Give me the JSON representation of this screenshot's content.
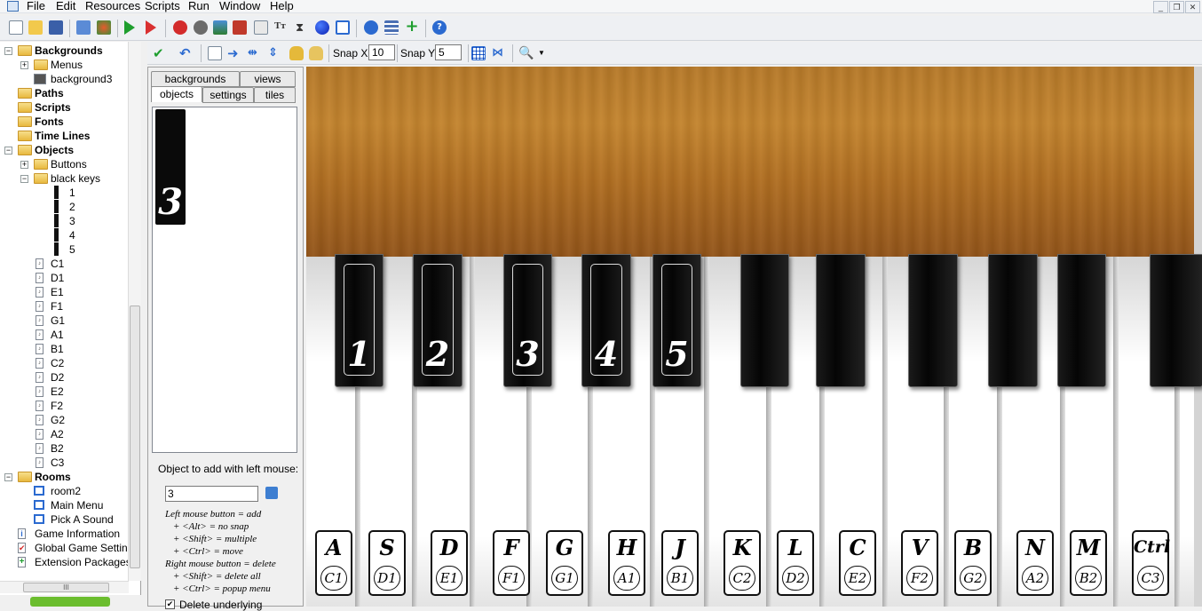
{
  "menu": [
    "File",
    "Edit",
    "Resources",
    "Scripts",
    "Run",
    "Window",
    "Help"
  ],
  "tree": {
    "items": [
      {
        "label": "Backgrounds",
        "level": 0,
        "bold": true,
        "kind": "folder",
        "exp": "-"
      },
      {
        "label": "Menus",
        "level": 1,
        "bold": false,
        "kind": "folder",
        "exp": "+"
      },
      {
        "label": "background3",
        "level": 1,
        "bold": false,
        "kind": "bg",
        "exp": ""
      },
      {
        "label": "Paths",
        "level": 0,
        "bold": true,
        "kind": "folder",
        "exp": ""
      },
      {
        "label": "Scripts",
        "level": 0,
        "bold": true,
        "kind": "folder",
        "exp": ""
      },
      {
        "label": "Fonts",
        "level": 0,
        "bold": true,
        "kind": "folder",
        "exp": ""
      },
      {
        "label": "Time Lines",
        "level": 0,
        "bold": true,
        "kind": "folder",
        "exp": ""
      },
      {
        "label": "Objects",
        "level": 0,
        "bold": true,
        "kind": "folder",
        "exp": "-"
      },
      {
        "label": "Buttons",
        "level": 1,
        "bold": false,
        "kind": "folder",
        "exp": "+"
      },
      {
        "label": "black keys",
        "level": 1,
        "bold": false,
        "kind": "folder",
        "exp": "-"
      },
      {
        "label": "1",
        "level": 2,
        "bold": false,
        "kind": "bk",
        "exp": ""
      },
      {
        "label": "2",
        "level": 2,
        "bold": false,
        "kind": "bk",
        "exp": ""
      },
      {
        "label": "3",
        "level": 2,
        "bold": false,
        "kind": "bk",
        "exp": ""
      },
      {
        "label": "4",
        "level": 2,
        "bold": false,
        "kind": "bk",
        "exp": ""
      },
      {
        "label": "5",
        "level": 2,
        "bold": false,
        "kind": "bk",
        "exp": ""
      },
      {
        "label": "C1",
        "level": 1,
        "bold": false,
        "kind": "res",
        "exp": ""
      },
      {
        "label": "D1",
        "level": 1,
        "bold": false,
        "kind": "res",
        "exp": ""
      },
      {
        "label": "E1",
        "level": 1,
        "bold": false,
        "kind": "res",
        "exp": ""
      },
      {
        "label": "F1",
        "level": 1,
        "bold": false,
        "kind": "res",
        "exp": ""
      },
      {
        "label": "G1",
        "level": 1,
        "bold": false,
        "kind": "res",
        "exp": ""
      },
      {
        "label": "A1",
        "level": 1,
        "bold": false,
        "kind": "res",
        "exp": ""
      },
      {
        "label": "B1",
        "level": 1,
        "bold": false,
        "kind": "res",
        "exp": ""
      },
      {
        "label": "C2",
        "level": 1,
        "bold": false,
        "kind": "res",
        "exp": ""
      },
      {
        "label": "D2",
        "level": 1,
        "bold": false,
        "kind": "res",
        "exp": ""
      },
      {
        "label": "E2",
        "level": 1,
        "bold": false,
        "kind": "res",
        "exp": ""
      },
      {
        "label": "F2",
        "level": 1,
        "bold": false,
        "kind": "res",
        "exp": ""
      },
      {
        "label": "G2",
        "level": 1,
        "bold": false,
        "kind": "res",
        "exp": ""
      },
      {
        "label": "A2",
        "level": 1,
        "bold": false,
        "kind": "res",
        "exp": ""
      },
      {
        "label": "B2",
        "level": 1,
        "bold": false,
        "kind": "res",
        "exp": ""
      },
      {
        "label": "C3",
        "level": 1,
        "bold": false,
        "kind": "res",
        "exp": ""
      },
      {
        "label": "Rooms",
        "level": 0,
        "bold": true,
        "kind": "folder",
        "exp": "-"
      },
      {
        "label": "room2",
        "level": 1,
        "bold": false,
        "kind": "room",
        "exp": ""
      },
      {
        "label": "Main Menu",
        "level": 1,
        "bold": false,
        "kind": "room",
        "exp": ""
      },
      {
        "label": "Pick A Sound",
        "level": 1,
        "bold": false,
        "kind": "room",
        "exp": ""
      },
      {
        "label": "Game Information",
        "level": 0,
        "bold": false,
        "kind": "info",
        "exp": ""
      },
      {
        "label": "Global Game Settings",
        "level": 0,
        "bold": false,
        "kind": "settings",
        "exp": ""
      },
      {
        "label": "Extension Packages",
        "level": 0,
        "bold": false,
        "kind": "ext",
        "exp": ""
      }
    ],
    "scroll_label": "III"
  },
  "room_toolbar": {
    "snap_x_label": "Snap X:",
    "snap_x_value": "10",
    "snap_y_label": "Snap Y:",
    "snap_y_value": "5"
  },
  "panel": {
    "tabs_top": [
      "backgrounds",
      "views"
    ],
    "tabs_bottom": [
      "objects",
      "settings",
      "tiles"
    ],
    "selected_object_number": "3",
    "object_label": "Object to add with left mouse:",
    "object_value": "3",
    "hints": [
      "Left mouse button = add",
      "+ <Alt> = no snap",
      "+ <Shift> = multiple",
      "+ <Ctrl> = move",
      "Right mouse button = delete",
      "+ <Shift> = delete all",
      "+ <Ctrl> = popup menu"
    ],
    "delete_underlying": "Delete underlying"
  },
  "room": {
    "black_keys": [
      {
        "number": "1"
      },
      {
        "number": "2"
      },
      {
        "number": "3"
      },
      {
        "number": "4"
      },
      {
        "number": "5"
      },
      {
        "number": ""
      },
      {
        "number": ""
      },
      {
        "number": ""
      },
      {
        "number": ""
      },
      {
        "number": ""
      },
      {
        "number": ""
      }
    ],
    "key_labels": [
      {
        "letter": "A",
        "note": "C1"
      },
      {
        "letter": "S",
        "note": "D1"
      },
      {
        "letter": "D",
        "note": "E1"
      },
      {
        "letter": "F",
        "note": "F1"
      },
      {
        "letter": "G",
        "note": "G1"
      },
      {
        "letter": "H",
        "note": "A1"
      },
      {
        "letter": "J",
        "note": "B1"
      },
      {
        "letter": "K",
        "note": "C2"
      },
      {
        "letter": "L",
        "note": "D2"
      },
      {
        "letter": "C",
        "note": "E2"
      },
      {
        "letter": "V",
        "note": "F2"
      },
      {
        "letter": "B",
        "note": "G2"
      },
      {
        "letter": "N",
        "note": "A2"
      },
      {
        "letter": "M",
        "note": "B2"
      },
      {
        "letter": "Ctrl",
        "note": "C3"
      }
    ]
  }
}
